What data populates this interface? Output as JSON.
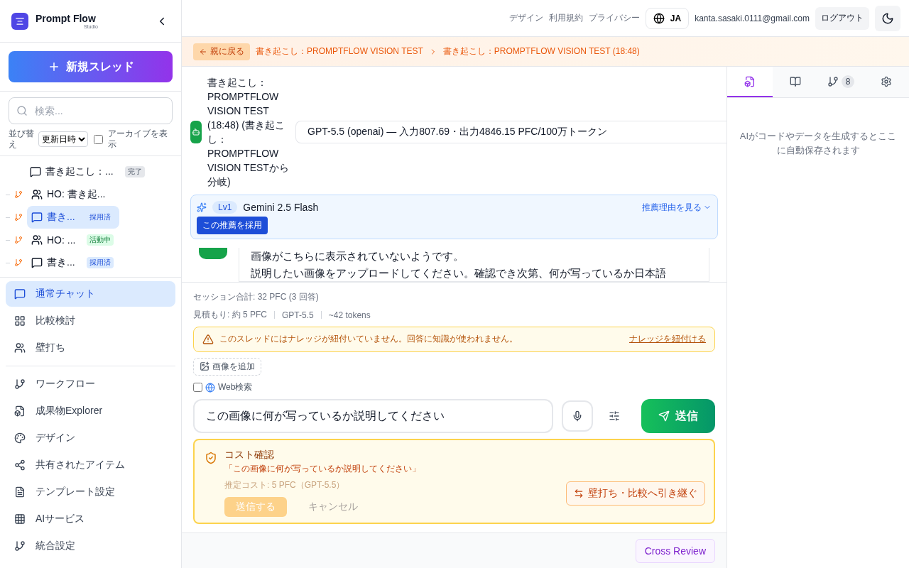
{
  "brand": {
    "name": "Prompt Flow",
    "subtitle": "Studio"
  },
  "new_thread_button": "新規スレッド",
  "search": {
    "placeholder": "検索..."
  },
  "sort": {
    "label": "並び替え",
    "value": "更新日時"
  },
  "archive_toggle": {
    "label": "アーカイブを表示",
    "checked": false
  },
  "thread_tree": [
    {
      "title": "書き起こし：...",
      "kind": "chat",
      "selected": false,
      "status": {
        "label": "完了",
        "color": "#e5e7eb"
      },
      "children": [
        {
          "title": "HO: 書き起...",
          "kind": "people",
          "selected": false
        },
        {
          "title": "書き...",
          "kind": "chat",
          "selected": true,
          "status": {
            "label": "採用済",
            "color": "#dbeafe"
          }
        },
        {
          "title": "HO: ...",
          "kind": "people",
          "selected": false,
          "status": {
            "label": "活動中",
            "color": "#dcfce7"
          }
        },
        {
          "title": "書き...",
          "kind": "chat",
          "selected": false,
          "status": {
            "label": "採用済",
            "color": "#dbeafe"
          }
        }
      ]
    }
  ],
  "nav_groups": [
    [
      {
        "label": "通常チャット",
        "kind": "chat",
        "selected": true
      },
      {
        "label": "比較検討",
        "kind": "grid",
        "selected": false
      },
      {
        "label": "壁打ち",
        "kind": "people",
        "selected": false
      }
    ],
    [
      {
        "label": "ワークフロー",
        "kind": "branch",
        "selected": false
      },
      {
        "label": "成果物Explorer",
        "kind": "file",
        "selected": false
      },
      {
        "label": "デザイン",
        "kind": "palette",
        "selected": false
      },
      {
        "label": "共有されたアイテム",
        "kind": "share",
        "selected": false
      },
      {
        "label": "テンプレート設定",
        "kind": "doc",
        "selected": false
      },
      {
        "label": "AIサービス",
        "kind": "table",
        "selected": false
      },
      {
        "label": "統合設定",
        "kind": "branch",
        "selected": false
      }
    ]
  ],
  "header": {
    "links": [
      "デザイン",
      "利用規約",
      "プライバシー"
    ],
    "language": "JA",
    "email": "kanta.sasaki.0111@gmail.com",
    "logout": "ログアウト"
  },
  "breadcrumb": {
    "back": "親に戻る",
    "crumbs": [
      "書き起こし：PROMPTFLOW VISION TEST",
      "書き起こし：PROMPTFLOW VISION TEST (18:48)"
    ]
  },
  "thread_title": "書き起こし：PROMPTFLOW VISION TEST (18:48) (書き起こし：PROMPTFLOW VISION TESTから分岐)",
  "model_select": {
    "value": "GPT-5.5 (openai) — 入力807.69・出力4846.15 PFC/100万トークン"
  },
  "recommendation": {
    "level": "Lv1",
    "model": "Gemini 2.5 Flash",
    "reason_link": "推薦理由を見る",
    "adopt_button": "この推薦を採用"
  },
  "message": {
    "lines": [
      "画像がこちらに表示されていないようです。",
      "説明したい画像をアップロードしてください。確認でき次第、何が写っているか日本語"
    ]
  },
  "session_total": "セッション合計: 32 PFC (3 回答)",
  "estimate": [
    "見積もり: 約 5 PFC",
    "GPT-5.5",
    "~42 tokens"
  ],
  "warning": {
    "text": "このスレッドにはナレッジが紐付いていません。回答に知識が使われません。",
    "link": "ナレッジを紐付ける"
  },
  "add_image_button": "画像を追加",
  "web_search": {
    "label": "Web検索",
    "checked": false
  },
  "composer": {
    "value": "この画像に何が写っているか説明してください",
    "send": "送信"
  },
  "cost_confirm": {
    "title": "コスト確認",
    "quote": "「この画像に何が写っているか説明してください」",
    "estimate": "推定コスト: 5 PFC（GPT-5.5）",
    "confirm": "送信する",
    "cancel": "キャンセル",
    "handoff": "壁打ち・比較へ引き継ぐ"
  },
  "footer_button": "Cross Review",
  "right_tabs": [
    {
      "kind": "file",
      "selected": true
    },
    {
      "kind": "book",
      "selected": false
    },
    {
      "kind": "branch",
      "selected": false,
      "count": "8"
    },
    {
      "kind": "gear",
      "selected": false
    }
  ],
  "right_empty_text": "AIがコードやデータを生成するとここに自動保存されます"
}
